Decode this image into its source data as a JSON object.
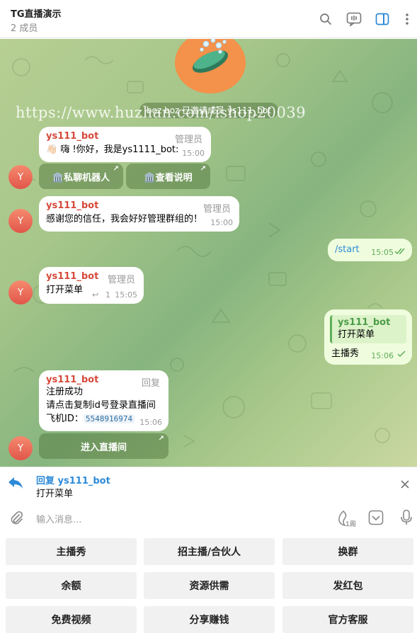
{
  "header": {
    "title": "TG直播演示",
    "subtitle": "2 成员"
  },
  "chat": {
    "watermark": "https://www.huzhan.com/ishop20039",
    "service_message": "boz boz 已邀请成员 ys111_bot",
    "messages": [
      {
        "sender": "ys111_bot",
        "role": "管理员",
        "text": "👋🏻 嗨 !你好，我是ys1111_bot:",
        "time": "15:00",
        "avatar_letter": "Y",
        "buttons": [
          "🏛️私聊机器人",
          "🏛️查看说明"
        ]
      },
      {
        "sender": "ys111_bot",
        "role": "管理员",
        "text": "感谢您的信任，我会好好管理群组的！",
        "time": "15:00",
        "avatar_letter": "Y"
      },
      {
        "outgoing": true,
        "text": "/start",
        "time": "15:05"
      },
      {
        "sender": "ys111_bot",
        "role": "管理员",
        "text": "打开菜单",
        "replies_count": "1",
        "time": "15:05",
        "avatar_letter": "Y"
      },
      {
        "outgoing": true,
        "quote_name": "ys111_bot",
        "quote_text": "打开菜单",
        "text": "主播秀",
        "time": "15:06"
      },
      {
        "sender": "ys111_bot",
        "role": "回复",
        "lines": [
          "注册成功",
          "请点击复制id号登录直播间"
        ],
        "id_label": "飞机ID：",
        "id_value": "5548916974",
        "time": "15:06",
        "avatar_letter": "Y",
        "buttons": [
          "进入直播间"
        ]
      }
    ]
  },
  "reply_bar": {
    "label": "回复 ys111_bot",
    "text": "打开菜单"
  },
  "input": {
    "placeholder": "输入消息...",
    "timer_label": "1周"
  },
  "keyboard": {
    "rows": [
      [
        "主播秀",
        "招主播/合伙人",
        "换群"
      ],
      [
        "余额",
        "资源供需",
        "发红包"
      ],
      [
        "免费视频",
        "分享赚钱",
        "官方客服"
      ]
    ]
  },
  "colors": {
    "accent": "#2d8ad9",
    "sender": "#d6493a",
    "outgoing_bubble": "#effdde",
    "check": "#5fae5a"
  }
}
